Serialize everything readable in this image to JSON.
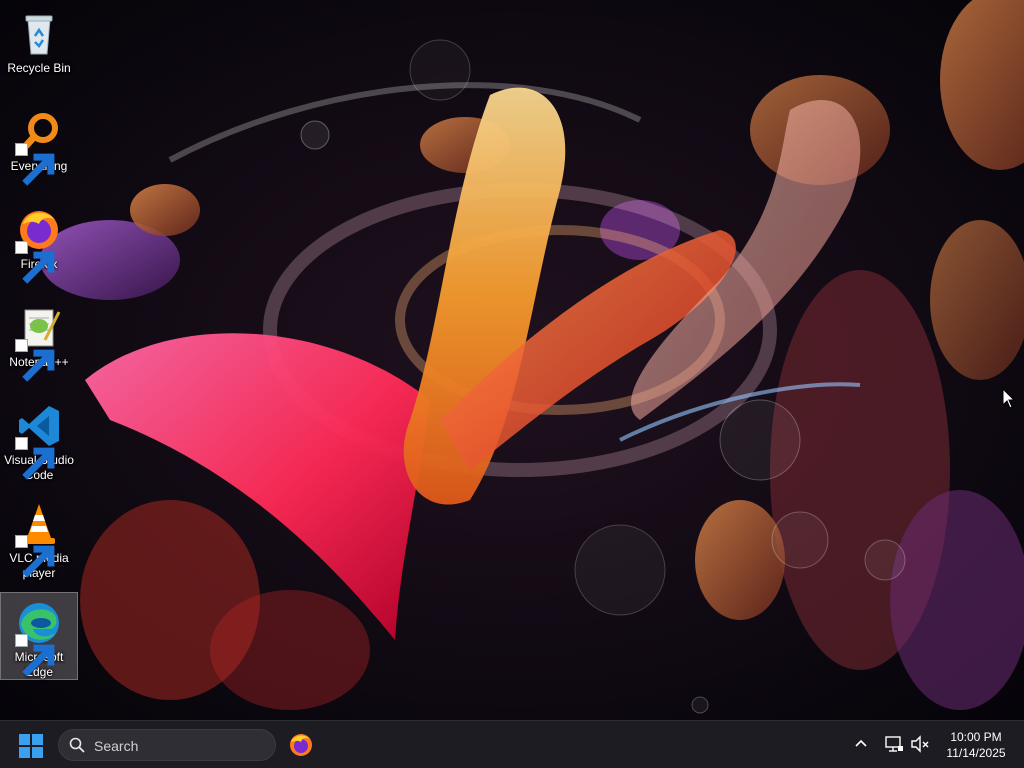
{
  "desktop": {
    "icons": [
      {
        "label": "Recycle Bin",
        "icon": "recycle-bin-icon",
        "shortcut": false
      },
      {
        "label": "Everything",
        "icon": "everything-icon",
        "shortcut": true
      },
      {
        "label": "Firefox",
        "icon": "firefox-icon",
        "shortcut": true
      },
      {
        "label": "Notepad++",
        "icon": "notepad-plus-plus-icon",
        "shortcut": true
      },
      {
        "label": "Visual Studio\nCode",
        "icon": "vscode-icon",
        "shortcut": true
      },
      {
        "label": "VLC media\nplayer",
        "icon": "vlc-icon",
        "shortcut": true
      },
      {
        "label": "Microsoft\nEdge",
        "icon": "edge-icon",
        "shortcut": true,
        "selected": true
      }
    ]
  },
  "taskbar": {
    "search_placeholder": "Search",
    "pinned": [
      {
        "name": "Firefox",
        "icon": "firefox-icon"
      }
    ],
    "tray": {
      "icons": [
        "chevron-up-icon",
        "network-icon",
        "volume-muted-icon"
      ],
      "time": "10:00 PM",
      "date": "11/14/2025"
    }
  },
  "colors": {
    "taskbar_bg": "#1c1c22",
    "start_blue": "#3aa0f0",
    "wallpaper_base": "#07060c"
  }
}
